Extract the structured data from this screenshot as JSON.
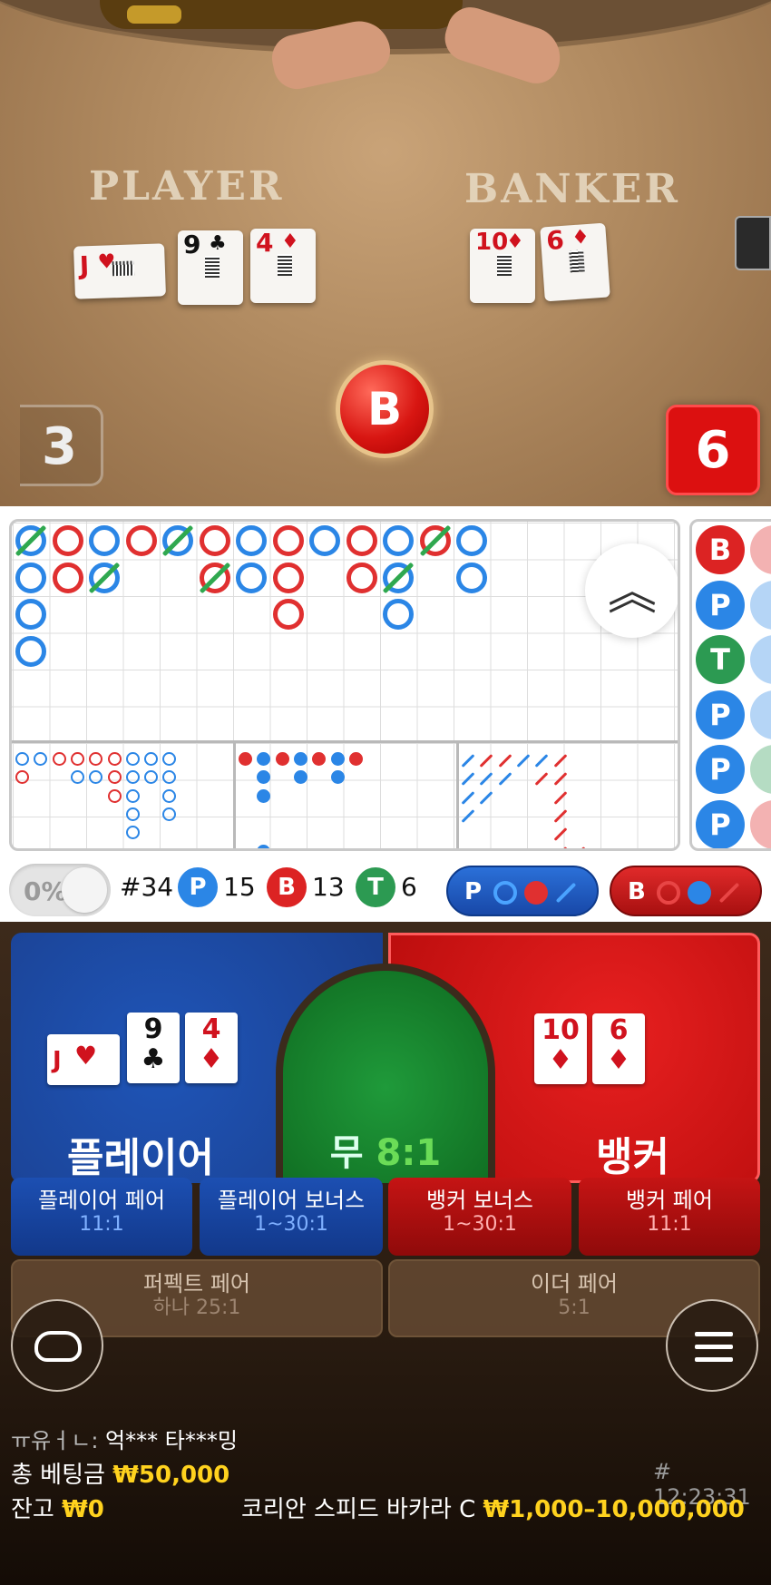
{
  "table": {
    "player_label": "PLAYER",
    "banker_label": "BANKER",
    "player_score": "3",
    "banker_score": "6",
    "winner_badge": "B",
    "player_cards": [
      {
        "rank": "J",
        "suit": "♥",
        "color": "red"
      },
      {
        "rank": "9",
        "suit": "♣",
        "color": "black"
      },
      {
        "rank": "4",
        "suit": "♦",
        "color": "red"
      }
    ],
    "banker_cards": [
      {
        "rank": "10",
        "suit": "♦",
        "color": "red"
      },
      {
        "rank": "6",
        "suit": "♦",
        "color": "red"
      }
    ]
  },
  "roadmap": {
    "collapse_icon": "double-chevron-up-icon",
    "side_road": [
      "B",
      "P",
      "T",
      "P",
      "P",
      "P"
    ]
  },
  "stats": {
    "percent": "0%",
    "round": "#34",
    "player_letter": "P",
    "player_count": "15",
    "banker_letter": "B",
    "banker_count": "13",
    "tie_letter": "T",
    "tie_count": "6",
    "player_ask": "P",
    "banker_ask": "B"
  },
  "bets": {
    "player_label": "플레이어",
    "banker_label": "뱅커",
    "tie_label": "무",
    "tie_odds": "8:1",
    "player_cards": [
      {
        "rank": "J",
        "suit": "♥",
        "color": "red"
      },
      {
        "rank": "9",
        "suit": "♣",
        "color": "black"
      },
      {
        "rank": "4",
        "suit": "♦",
        "color": "red"
      }
    ],
    "banker_cards": [
      {
        "rank": "10",
        "suit": "♦",
        "color": "red"
      },
      {
        "rank": "6",
        "suit": "♦",
        "color": "red"
      }
    ],
    "side_bets": [
      {
        "title": "플레이어 페어",
        "odds": "11:1"
      },
      {
        "title": "플레이어 보너스",
        "odds": "1~30:1"
      },
      {
        "title": "뱅커 보너스",
        "odds": "1~30:1"
      },
      {
        "title": "뱅커 페어",
        "odds": "11:1"
      }
    ],
    "extra_bets": [
      {
        "title": "퍼펙트 페어",
        "odds": "하나 25:1"
      },
      {
        "title": "이더 페어",
        "odds": "5:1"
      }
    ]
  },
  "info": {
    "players_label": "ㅠ유ㅓㄴ:",
    "players": "억*** 타***밍",
    "total_bet_label": "총 베팅금",
    "total_bet": "₩50,000",
    "balance_label": "잔고",
    "balance": "₩0",
    "time": "# 12:23:31",
    "table_name": "코리안 스피드 바카라 C",
    "limits": "₩1,000–10,000,000"
  },
  "colors": {
    "player_blue": "#2b86e6",
    "banker_red": "#e03030",
    "tie_green": "#2c9a52",
    "gold": "#ffd21e"
  }
}
